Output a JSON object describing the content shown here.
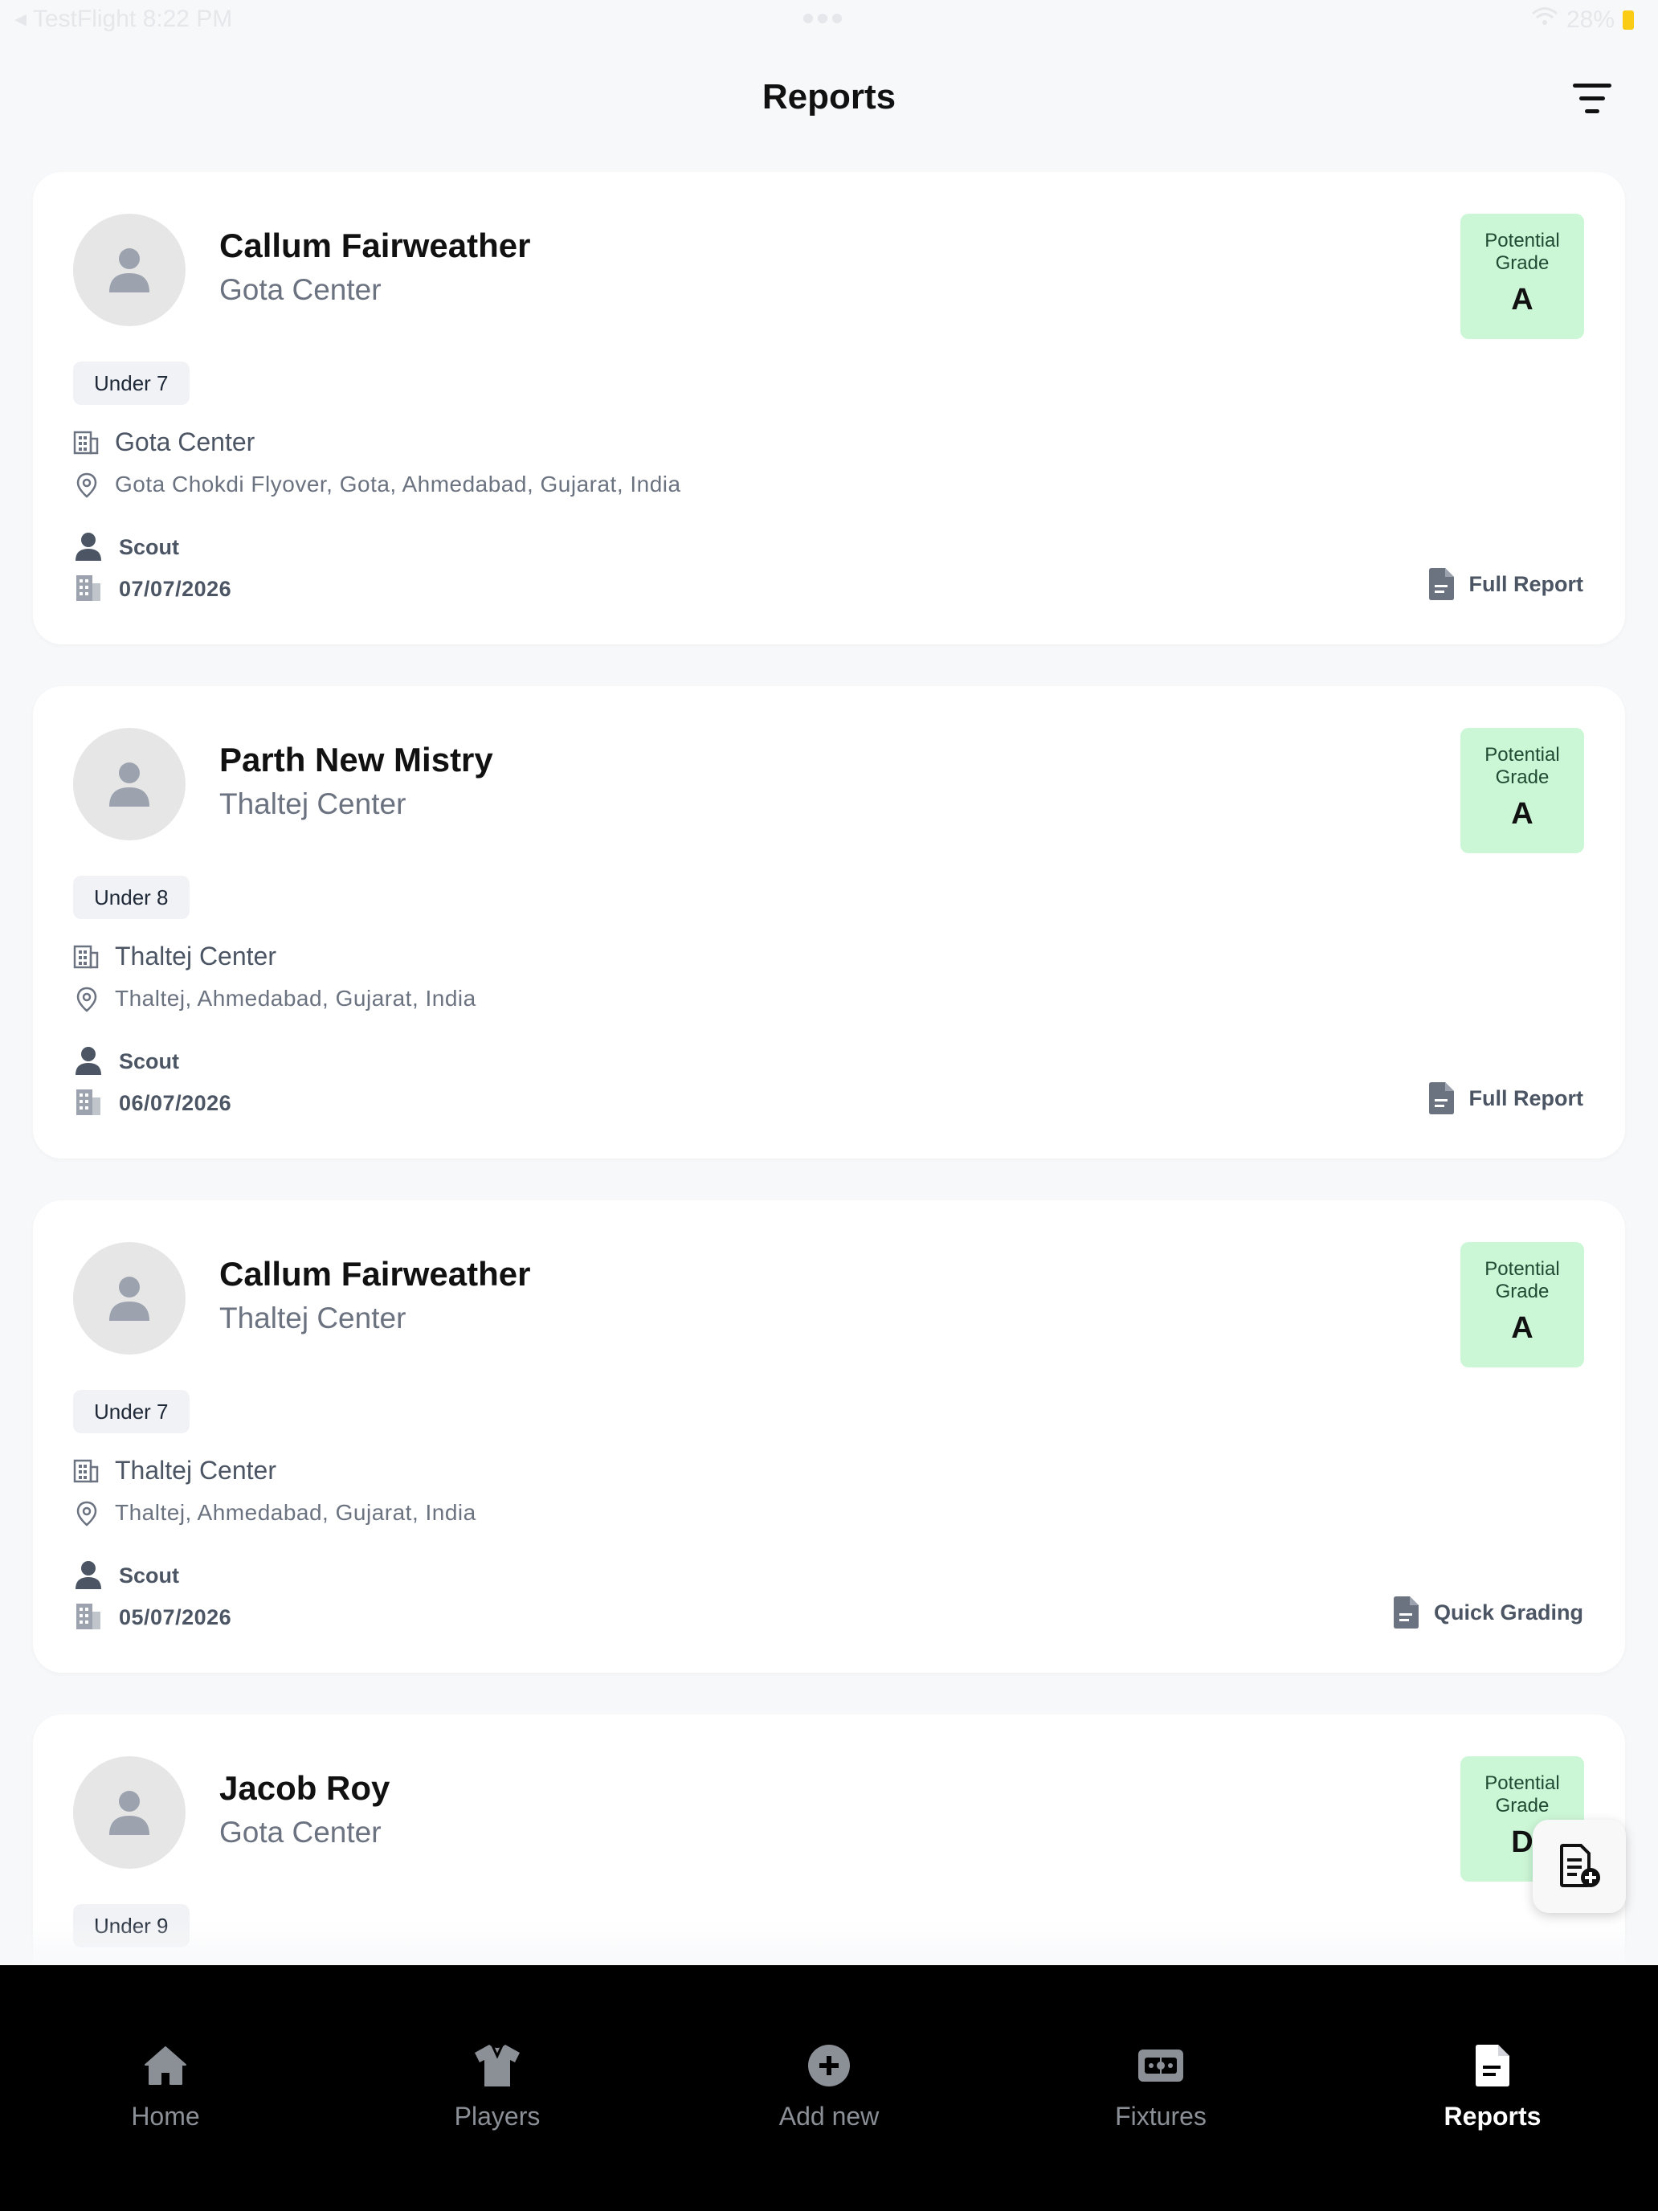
{
  "status_bar": {
    "left": "◂ TestFlight  8:22 PM",
    "right": "28%"
  },
  "header": {
    "title": "Reports"
  },
  "grade_label": "Potential Grade",
  "reports": [
    {
      "name": "Callum Fairweather",
      "center": "Gota Center",
      "grade": "A",
      "age_group": "Under 7",
      "venue": "Gota Center",
      "address": "Gota Chokdi Flyover, Gota, Ahmedabad, Gujarat, India",
      "role": "Scout",
      "date": "07/07/2026",
      "report_type": "Full Report"
    },
    {
      "name": "Parth New Mistry",
      "center": "Thaltej Center",
      "grade": "A",
      "age_group": "Under 8",
      "venue": "Thaltej Center",
      "address": "Thaltej, Ahmedabad, Gujarat, India",
      "role": "Scout",
      "date": "06/07/2026",
      "report_type": "Full Report"
    },
    {
      "name": "Callum Fairweather",
      "center": "Thaltej Center",
      "grade": "A",
      "age_group": "Under 7",
      "venue": "Thaltej Center",
      "address": "Thaltej, Ahmedabad, Gujarat, India",
      "role": "Scout",
      "date": "05/07/2026",
      "report_type": "Quick Grading"
    },
    {
      "name": "Jacob Roy",
      "center": "Gota Center",
      "grade": "D",
      "age_group": "Under 9"
    }
  ],
  "tabs": [
    {
      "label": "Home",
      "icon": "home-icon"
    },
    {
      "label": "Players",
      "icon": "shirt-icon"
    },
    {
      "label": "Add new",
      "icon": "plus-circle-icon"
    },
    {
      "label": "Fixtures",
      "icon": "stadium-icon"
    },
    {
      "label": "Reports",
      "icon": "report-icon",
      "active": true
    }
  ],
  "colors": {
    "grade_bg": "#ccf7d7",
    "tabbar_bg": "#000000",
    "active_tab": "#ffffff",
    "inactive_tab": "#8b8f96"
  }
}
